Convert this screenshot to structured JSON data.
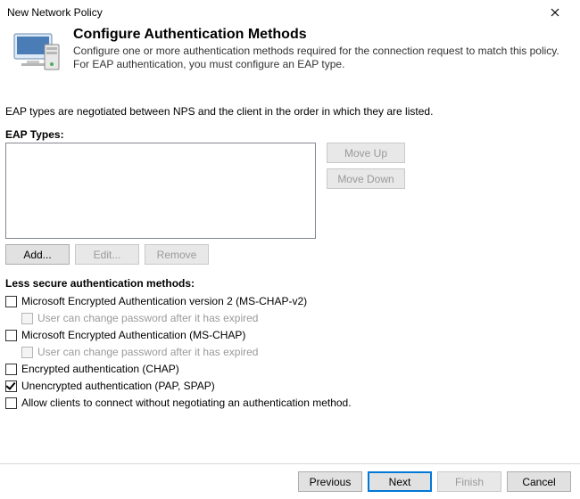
{
  "window": {
    "title": "New Network Policy"
  },
  "header": {
    "title": "Configure Authentication Methods",
    "desc": "Configure one or more authentication methods required for the connection request to match this policy. For EAP authentication, you must configure an EAP type."
  },
  "body": {
    "negotiate_line": "EAP types are negotiated between NPS and the client in the order in which they are listed.",
    "eap_label": "EAP Types:",
    "btn_moveup": "Move Up",
    "btn_movedown": "Move Down",
    "btn_add": "Add...",
    "btn_edit": "Edit...",
    "btn_remove": "Remove",
    "less_secure_label": "Less secure authentication methods:",
    "checks": {
      "mschapv2": "Microsoft Encrypted Authentication version 2 (MS-CHAP-v2)",
      "mschapv2_sub": "User can change password after it has expired",
      "mschap": "Microsoft Encrypted Authentication (MS-CHAP)",
      "mschap_sub": "User can change password after it has expired",
      "chap": "Encrypted authentication (CHAP)",
      "pap": "Unencrypted authentication (PAP, SPAP)",
      "allow_none": "Allow clients to connect without negotiating an authentication method."
    }
  },
  "footer": {
    "previous": "Previous",
    "next": "Next",
    "finish": "Finish",
    "cancel": "Cancel"
  }
}
